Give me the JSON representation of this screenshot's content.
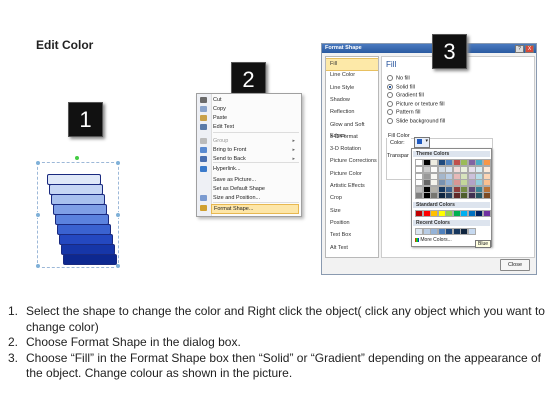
{
  "title": "Edit Color",
  "badges": [
    "1",
    "2",
    "3"
  ],
  "context_menu": {
    "items": [
      {
        "label": "Cut",
        "icon": "scissors-icon",
        "state": "normal"
      },
      {
        "label": "Copy",
        "icon": "copy-icon",
        "state": "normal"
      },
      {
        "label": "Paste",
        "icon": "paste-icon",
        "state": "normal"
      },
      {
        "label": "Edit Text",
        "icon": "edit-text-icon",
        "state": "normal"
      },
      {
        "label": "Group",
        "icon": "group-icon",
        "state": "dim",
        "arrow": "▸"
      },
      {
        "label": "Bring to Front",
        "icon": "bring-front-icon",
        "state": "normal",
        "arrow": "▸"
      },
      {
        "label": "Send to Back",
        "icon": "send-back-icon",
        "state": "normal",
        "arrow": "▸"
      },
      {
        "label": "Hyperlink...",
        "icon": "hyperlink-icon",
        "state": "normal"
      },
      {
        "label": "Save as Picture...",
        "icon": "",
        "state": "normal"
      },
      {
        "label": "Set as Default Shape",
        "icon": "",
        "state": "normal"
      },
      {
        "label": "Size and Position...",
        "icon": "size-icon",
        "state": "normal"
      },
      {
        "label": "Format Shape...",
        "icon": "format-shape-icon",
        "state": "highlight"
      }
    ]
  },
  "dialog": {
    "title": "Format Shape",
    "help": "?",
    "close_x": "X",
    "nav": [
      "Fill",
      "Line Color",
      "Line Style",
      "Shadow",
      "Reflection",
      "Glow and Soft Edges",
      "3-D Format",
      "3-D Rotation",
      "Picture Corrections",
      "Picture Color",
      "Artistic Effects",
      "Crop",
      "Size",
      "Position",
      "Text Box",
      "Alt Text"
    ],
    "fill_heading": "Fill",
    "fill_options": [
      {
        "label": "No fill",
        "selected": false
      },
      {
        "label": "Solid fill",
        "selected": true
      },
      {
        "label": "Gradient fill",
        "selected": false
      },
      {
        "label": "Picture or texture fill",
        "selected": false
      },
      {
        "label": "Pattern fill",
        "selected": false
      },
      {
        "label": "Slide background fill",
        "selected": false
      }
    ],
    "fill_color_group": "Fill Color",
    "color_label": "Color:",
    "transparency_label": "Transpar",
    "close_button": "Close"
  },
  "palette": {
    "theme_label": "Theme Colors",
    "standard_label": "Standard Colors",
    "recent_label": "Recent Colors",
    "more_label": "More Colors...",
    "tooltip": "Blue",
    "theme_top": [
      "#ffffff",
      "#000000",
      "#eeece1",
      "#1f497d",
      "#4f81bd",
      "#c0504d",
      "#9bbb59",
      "#8064a2",
      "#4bacc6",
      "#f79646"
    ],
    "standard": [
      "#c00000",
      "#ff0000",
      "#ffc000",
      "#ffff00",
      "#92d050",
      "#00b050",
      "#00b0f0",
      "#0070c0",
      "#002060",
      "#7030a0"
    ],
    "recent": [
      "#dbe5f1",
      "#b8cce4",
      "#95b3d7",
      "#4f81bd",
      "#1f497d",
      "#17375e",
      "#0f243e",
      "#c6d9f0"
    ]
  },
  "steps": [
    {
      "num": "1.",
      "text": "Select the shape to change the color and Right click the object( click any object which you want to change color)"
    },
    {
      "num": "2.",
      "text": "Choose Format Shape in the dialog box."
    },
    {
      "num": "3.",
      "text": "Choose “Fill” in the Format Shape box then “Solid” or “Gradient” depending on the appearance of the object. Change colour as shown in the picture."
    }
  ]
}
